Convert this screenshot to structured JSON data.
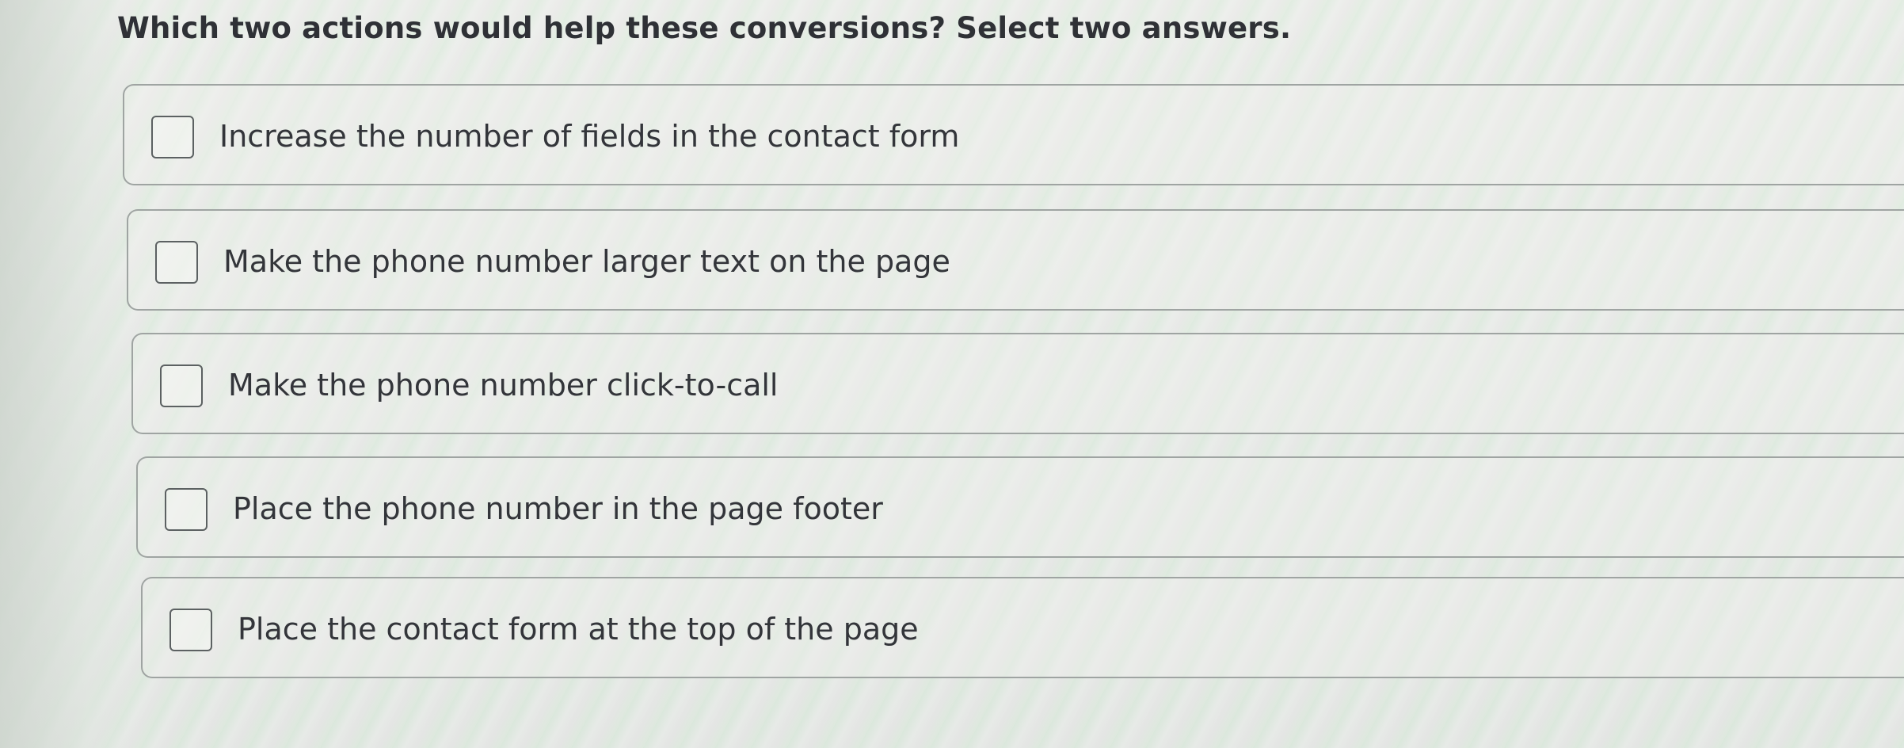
{
  "question": {
    "text": "Which two actions would help these conversions? Select two answers."
  },
  "options": [
    {
      "label": "Increase the number of fields in the contact form",
      "checked": false
    },
    {
      "label": "Make the phone number larger text on the page",
      "checked": false
    },
    {
      "label": "Make the phone number click-to-call",
      "checked": false
    },
    {
      "label": "Place the phone number in the page footer",
      "checked": false
    },
    {
      "label": "Place the contact form at the top of the page",
      "checked": false
    }
  ]
}
